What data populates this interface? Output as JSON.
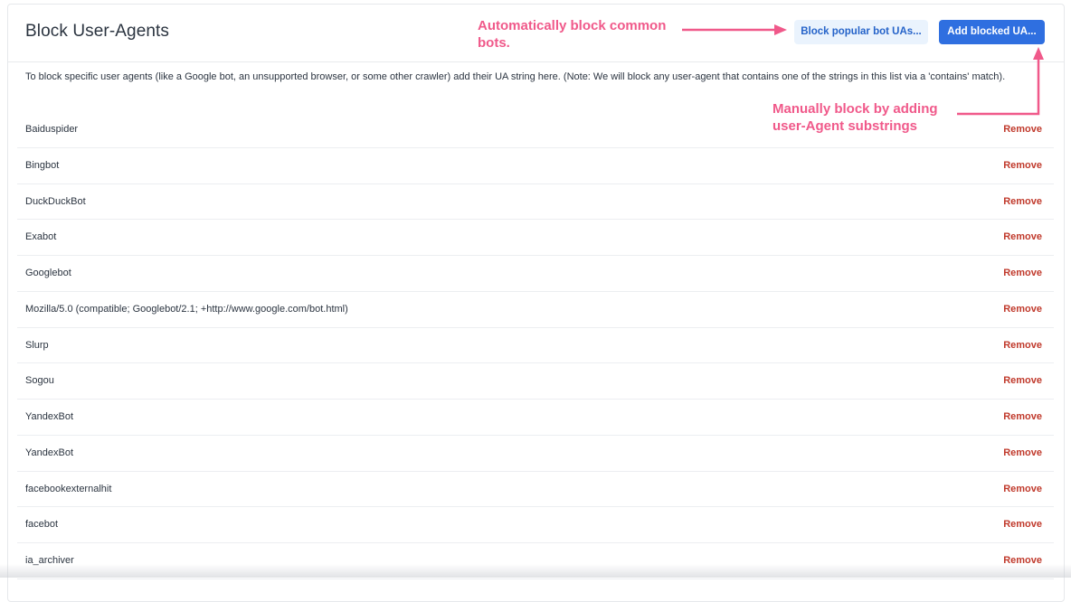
{
  "header": {
    "title": "Block User-Agents",
    "block_popular_label": "Block popular bot UAs...",
    "add_blocked_label": "Add blocked UA..."
  },
  "description": "To block specific user agents (like a Google bot, an unsupported browser, or some other crawler) add their UA string here. (Note: We will block any user-agent that contains one of the strings in this list via a 'contains' match).",
  "remove_label": "Remove",
  "user_agents": [
    "Baiduspider",
    "Bingbot",
    "DuckDuckBot",
    "Exabot",
    "Googlebot",
    "Mozilla/5.0 (compatible; Googlebot/2.1; +http://www.google.com/bot.html)",
    "Slurp",
    "Sogou",
    "YandexBot",
    "YandexBot",
    "facebookexternalhit",
    "facebot",
    "ia_archiver"
  ],
  "annotations": {
    "auto_line1": "Automatically block common",
    "auto_line2": "bots.",
    "manual_line1": "Manually block by adding",
    "manual_line2": "user-Agent substrings"
  },
  "colors": {
    "primary": "#2f6fe0",
    "light_button": "#eaf3fd",
    "remove": "#c0392b",
    "annotation": "#f0598a"
  }
}
